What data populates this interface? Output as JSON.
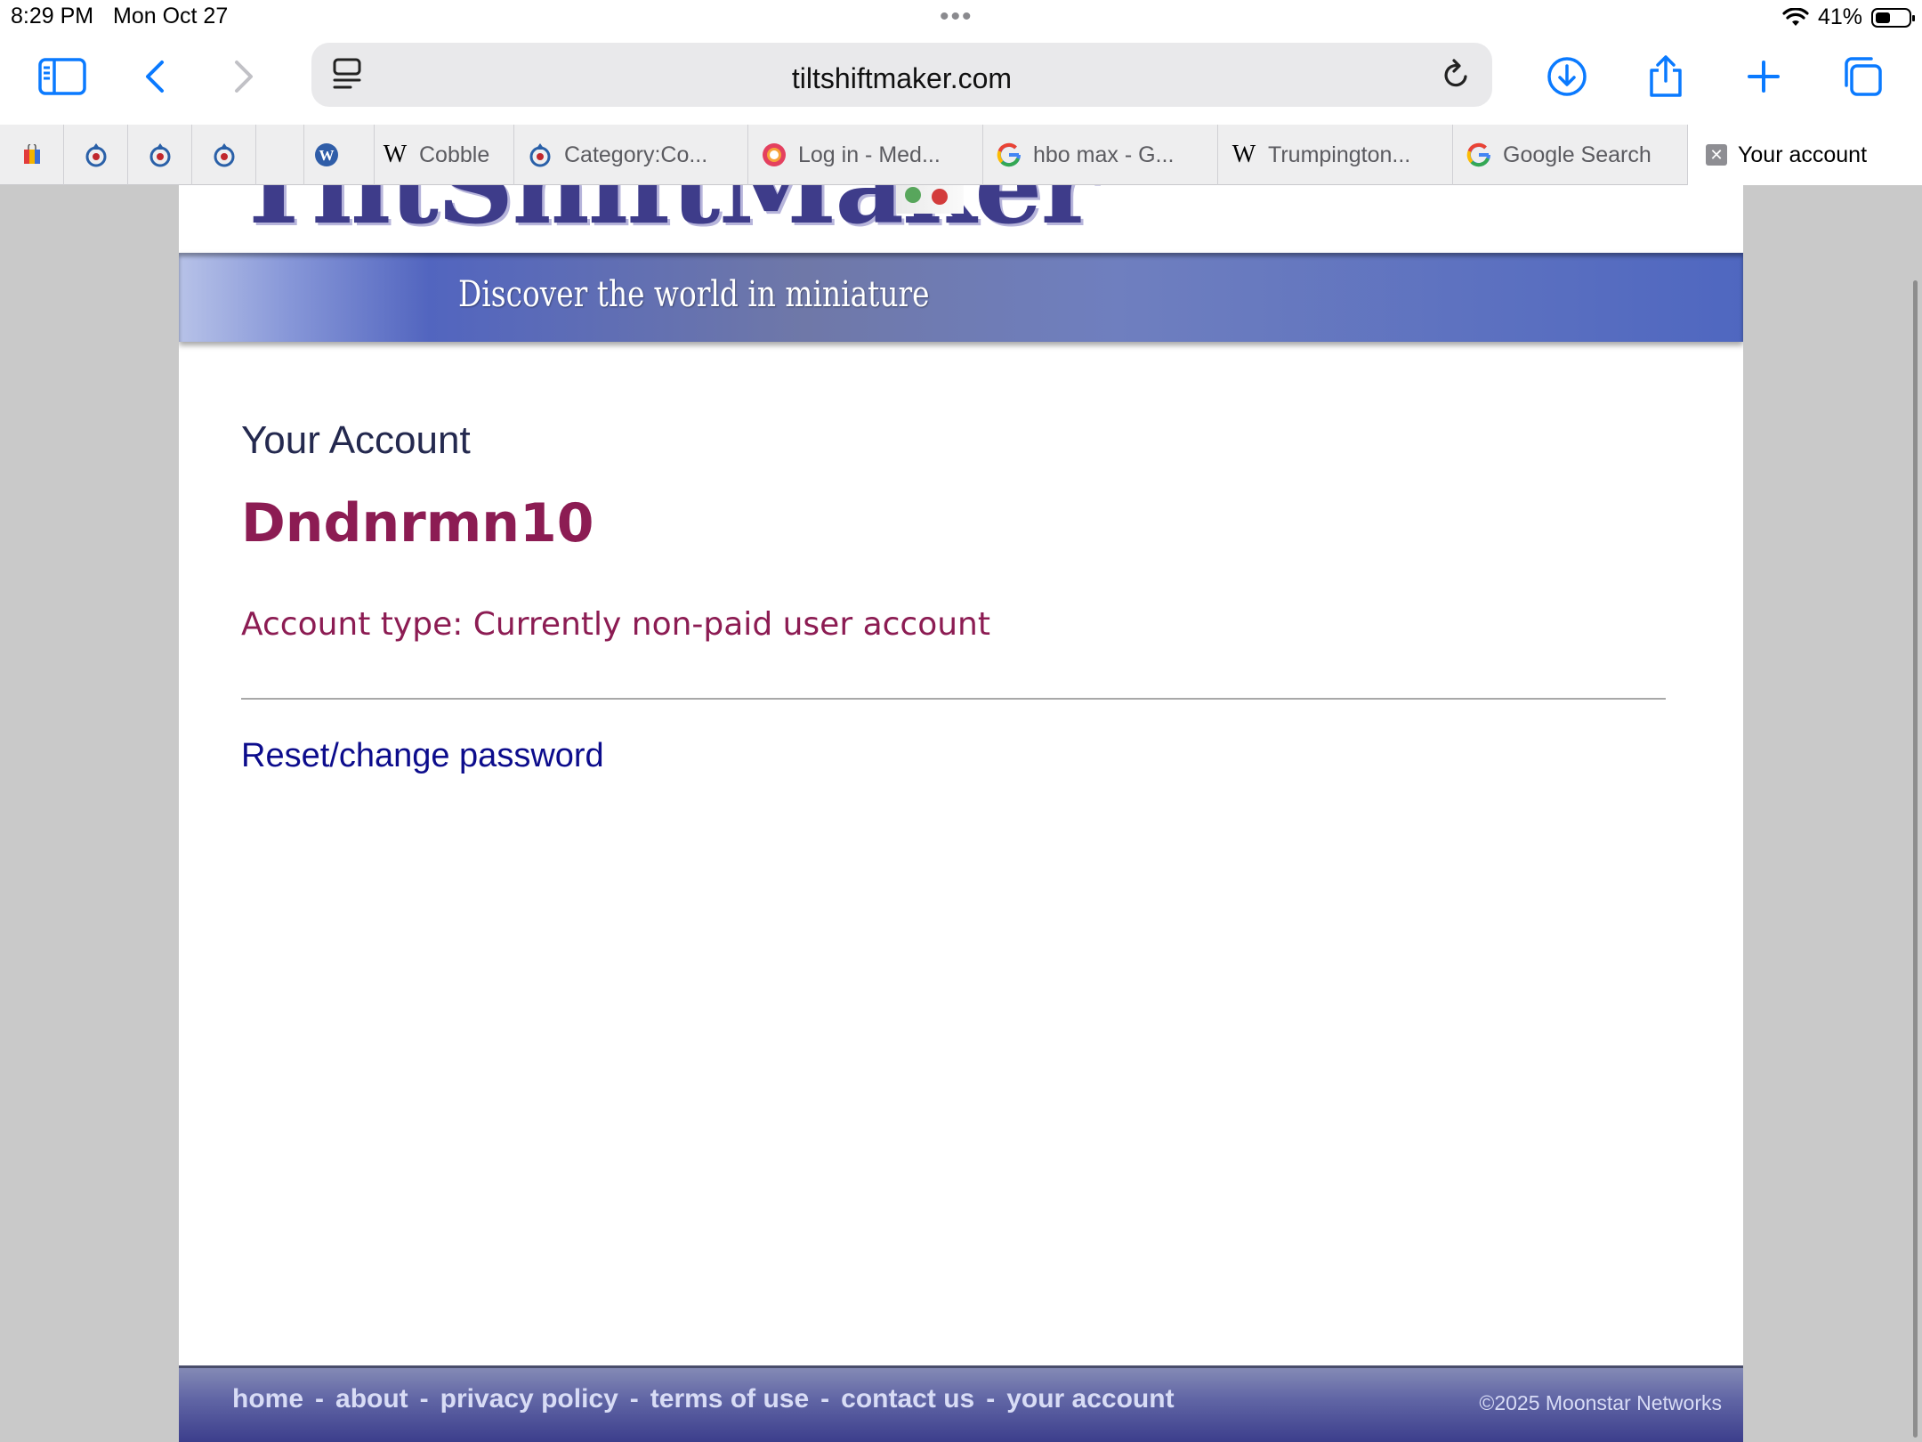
{
  "status": {
    "time": "8:29 PM",
    "date": "Mon Oct 27",
    "battery": "41%",
    "wifi_icon": "wifi-icon"
  },
  "toolbar": {
    "url": "tiltshiftmaker.com"
  },
  "tabs": [
    {
      "label": "Cobble",
      "icon": "wikipedia-icon"
    },
    {
      "label": "Category:Co...",
      "icon": "wikimedia-commons-icon"
    },
    {
      "label": "Log in - Med...",
      "icon": "medium-icon"
    },
    {
      "label": "hbo max - G...",
      "icon": "google-icon"
    },
    {
      "label": "Trumpington...",
      "icon": "wikipedia-icon"
    },
    {
      "label": "Google Search",
      "icon": "google-icon"
    },
    {
      "label": "Your account",
      "icon": "close-icon"
    }
  ],
  "site": {
    "logo_text": "TiltShiftMaker",
    "tagline": "Discover the world in miniature"
  },
  "account": {
    "heading": "Your Account",
    "username": "Dndnrmn10",
    "type_label": "Account type: Currently non-paid user account",
    "reset_link": "Reset/change password"
  },
  "footer": {
    "links": [
      "home",
      "about",
      "privacy policy",
      "terms of use",
      "contact us",
      "your account"
    ],
    "separator": "-",
    "copyright": "©2025 Moonstar Networks"
  },
  "colors": {
    "accent_magenta": "#8c1c53",
    "link_blue": "#0c0c8c",
    "ios_blue": "#0a7aff",
    "banner_blue": "#4f67c0"
  }
}
